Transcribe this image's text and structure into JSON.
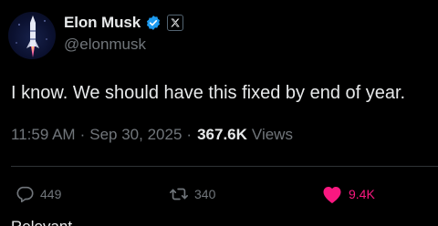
{
  "author": {
    "display_name": "Elon Musk",
    "handle": "@elonmusk",
    "verified_icon": "verified-badge-icon",
    "affiliation_icon": "x-logo-icon"
  },
  "tweet": {
    "text": "I know. We should have this fixed by end of year.",
    "time": "11:59 AM",
    "separator": "·",
    "date": "Sep 30, 2025",
    "views_count": "367.6K",
    "views_label": "Views"
  },
  "actions": {
    "reply_count": "449",
    "retweet_count": "340",
    "like_count": "9.4K"
  },
  "footer": {
    "partial_text": "Relevant"
  },
  "colors": {
    "background": "#000000",
    "text_primary": "#e7e9ea",
    "text_secondary": "#71767b",
    "verified_blue": "#1d9bf0",
    "like_pink": "#f91880",
    "divider": "#2f3336"
  }
}
